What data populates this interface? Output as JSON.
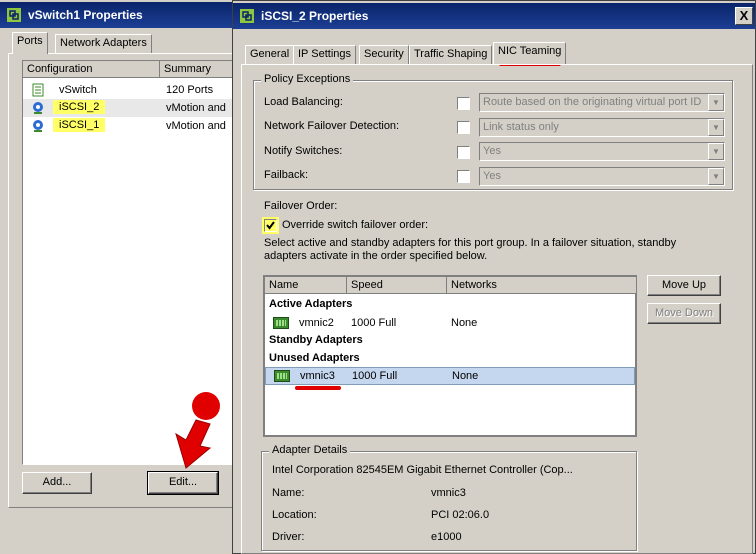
{
  "left_window": {
    "title": "vSwitch1 Properties",
    "tabs": [
      "Ports",
      "Network Adapters"
    ],
    "columns": [
      "Configuration",
      "Summary"
    ],
    "rows": [
      {
        "name": "vSwitch",
        "summary": "120 Ports"
      },
      {
        "name": "iSCSI_2",
        "summary": "vMotion and"
      },
      {
        "name": "iSCSI_1",
        "summary": "vMotion and"
      }
    ],
    "add_label": "Add...",
    "edit_label": "Edit..."
  },
  "right_window": {
    "title": "iSCSI_2 Properties",
    "close": "X",
    "tabs": [
      "General",
      "IP Settings",
      "Security",
      "Traffic Shaping",
      "NIC Teaming"
    ],
    "policy_exceptions": {
      "label": "Policy Exceptions",
      "load_balancing": {
        "label": "Load Balancing:",
        "value": "Route based on the originating virtual port ID"
      },
      "failover_detection": {
        "label": "Network Failover Detection:",
        "value": "Link status only"
      },
      "notify_switches": {
        "label": "Notify Switches:",
        "value": "Yes"
      },
      "failback": {
        "label": "Failback:",
        "value": "Yes"
      }
    },
    "failover_order": {
      "label": "Failover Order:",
      "override_label": "Override switch failover order:",
      "description_1": "Select active and standby adapters for this port group.  In a failover situation, standby",
      "description_2": "adapters activate  in the order specified below."
    },
    "adapter_table": {
      "columns": [
        "Name",
        "Speed",
        "Networks"
      ],
      "active_header": "Active Adapters",
      "standby_header": "Standby Adapters",
      "unused_header": "Unused Adapters",
      "active": [
        {
          "name": "vmnic2",
          "speed": "1000 Full",
          "networks": "None"
        }
      ],
      "unused": [
        {
          "name": "vmnic3",
          "speed": "1000 Full",
          "networks": "None"
        }
      ]
    },
    "move_up": "Move Up",
    "move_down": "Move Down",
    "adapter_details": {
      "label": "Adapter Details",
      "description": "Intel Corporation 82545EM Gigabit Ethernet Controller (Cop...",
      "name_label": "Name:",
      "name_value": "vmnic3",
      "location_label": "Location:",
      "location_value": "PCI 02:06.0",
      "driver_label": "Driver:",
      "driver_value": "e1000"
    }
  },
  "colors": {
    "title_blue": "#0a246a",
    "highlight_yellow": "#ffff66",
    "annotation_red": "#e00000",
    "selection": "#c5d7ef"
  }
}
